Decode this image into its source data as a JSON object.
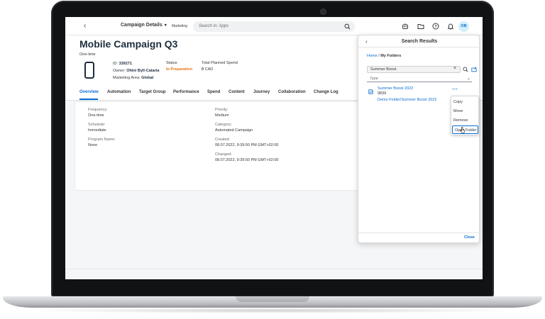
{
  "shellbar": {
    "app_title": "Campaign Details",
    "app_subtitle": "Marketing",
    "search_placeholder": "Search in: Apps",
    "avatar_initials": "OB"
  },
  "header": {
    "title": "Mobile Campaign Q3",
    "subtitle": "One-time",
    "id_label": "ID:",
    "id_value": "339271",
    "owner_label": "Owner:",
    "owner_value": "Ohini Byll-Cataria",
    "area_label": "Marketing Area:",
    "area_value": "Global",
    "status_label": "Status",
    "status_value": "In Preparation",
    "spend_label": "Total Planned Spend",
    "spend_amount": "0",
    "spend_currency": "CAD"
  },
  "tabs": [
    {
      "label": "Overview"
    },
    {
      "label": "Automation"
    },
    {
      "label": "Target Group"
    },
    {
      "label": "Performance"
    },
    {
      "label": "Spend"
    },
    {
      "label": "Content"
    },
    {
      "label": "Journey"
    },
    {
      "label": "Collaboration"
    },
    {
      "label": "Change Log"
    }
  ],
  "details": {
    "frequency_label": "Frequency:",
    "frequency_value": "One-time",
    "schedule_label": "Schedule:",
    "schedule_value": "Immediate",
    "program_label": "Program Name:",
    "program_value": "None",
    "priority_label": "Priority:",
    "priority_value": "Medium",
    "category_label": "Category:",
    "category_value": "Automated Campaign",
    "created_label": "Created:",
    "created_value": "08.07.2022, 9:39:50 PM GMT+02:00",
    "changed_label": "Changed:",
    "changed_value": "08.07.2022, 9:39:50 PM GMT+02:00"
  },
  "search_results": {
    "title": "Search Results",
    "breadcrumb_home": "Home",
    "breadcrumb_sep": "/",
    "breadcrumb_current": "My Folders",
    "search_value": "Summer Boost",
    "type_placeholder": "Type",
    "result_name": "Summer Boost 2022",
    "result_id": "9839",
    "result_path": "Demo Folder/Summer Boost 2022",
    "close_label": "Close"
  },
  "context_menu": {
    "items": [
      "Copy",
      "Move",
      "Remove",
      "Open Folder"
    ]
  },
  "colors": {
    "accent": "#0a6ed1",
    "status": "#e9730c",
    "title": "#1d2d3e"
  }
}
